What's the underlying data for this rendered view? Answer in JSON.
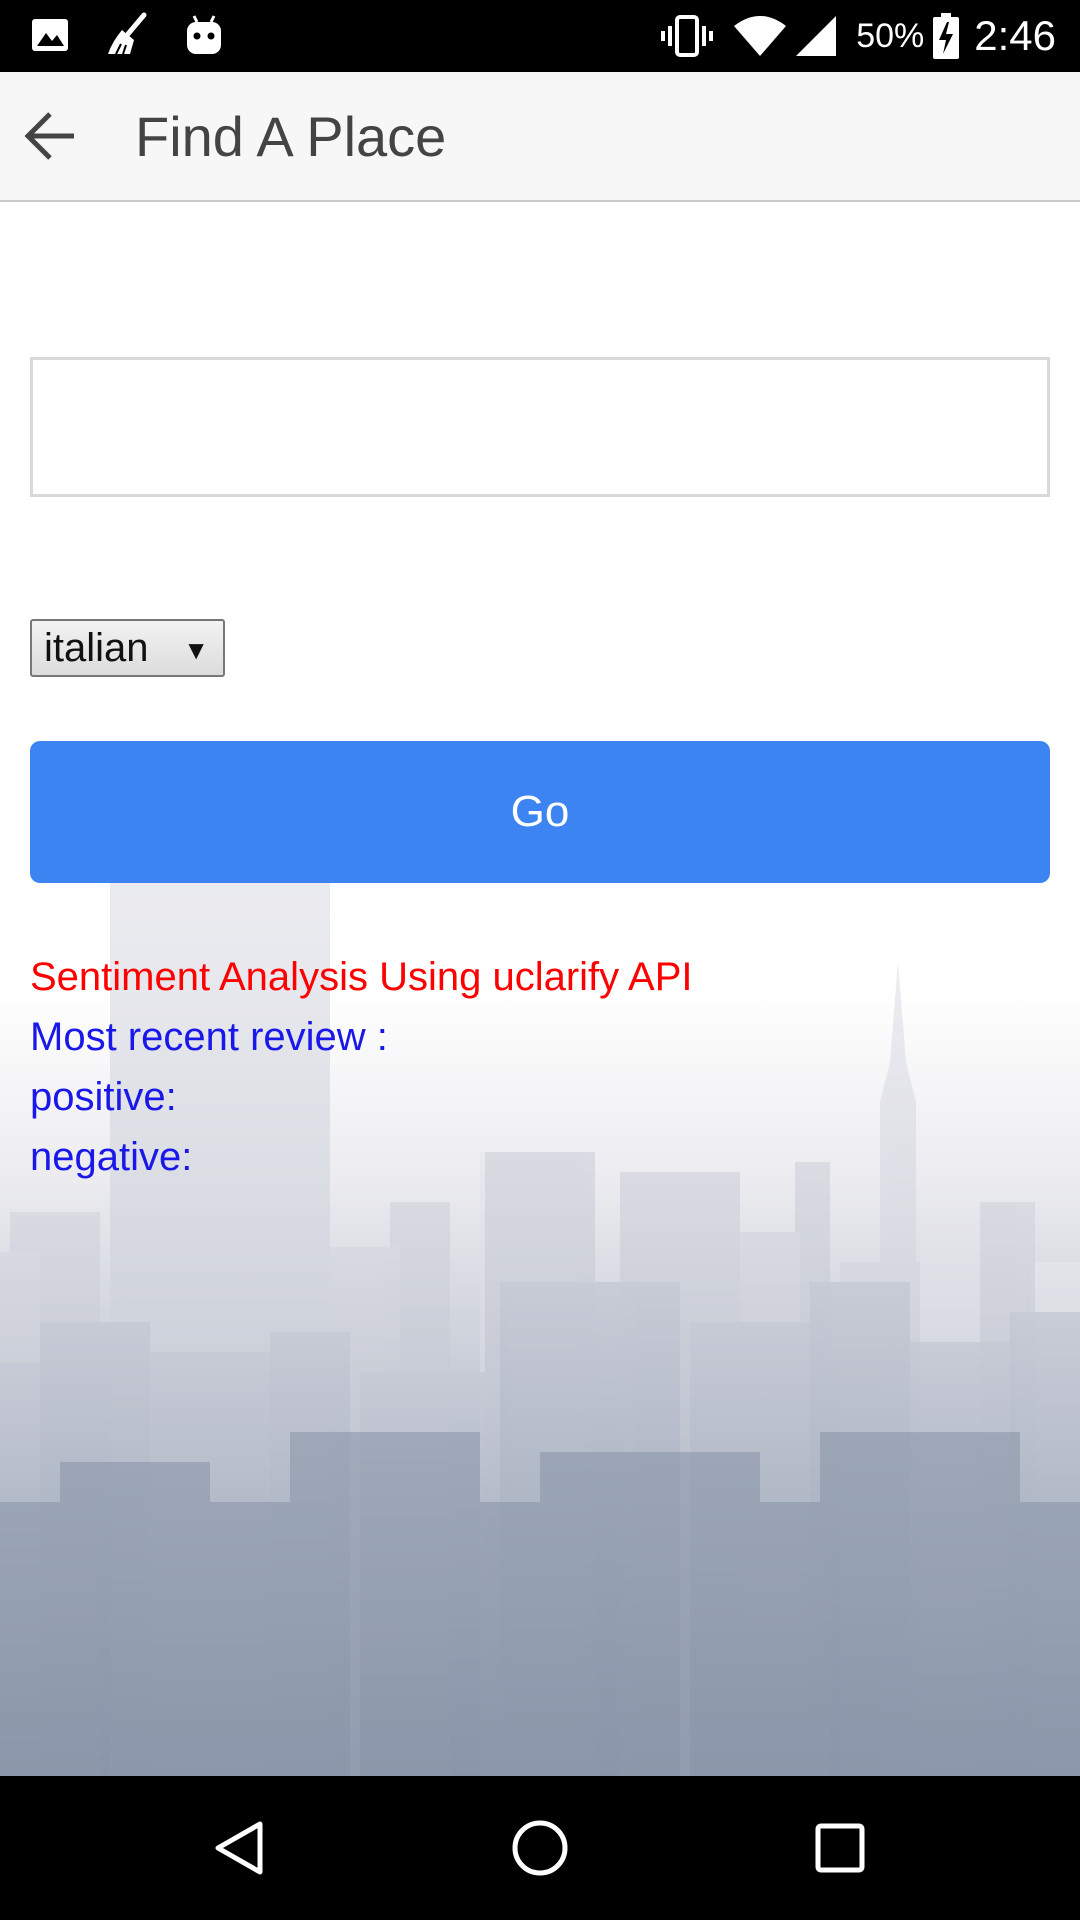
{
  "status_bar": {
    "left_icons": [
      "image-icon",
      "broom-icon",
      "android-icon"
    ],
    "right_icons": [
      "vibrate-icon",
      "wifi-icon",
      "signal-icon",
      "battery-charging-icon"
    ],
    "battery_percent": "50%",
    "time": "2:46"
  },
  "app_bar": {
    "title": "Find A Place",
    "back_icon": "arrow-back-icon"
  },
  "search": {
    "value": "",
    "placeholder": ""
  },
  "cuisine_select": {
    "selected": "italian",
    "arrow": "▼"
  },
  "go_button": {
    "label": "Go"
  },
  "results": {
    "heading": "Sentiment Analysis Using uclarify API",
    "recent_review_label": "Most recent review :",
    "positive_label": "positive:",
    "negative_label": "negative:"
  },
  "nav_bar": {
    "icons": [
      "back-triangle-icon",
      "home-circle-icon",
      "recents-square-icon"
    ]
  },
  "colors": {
    "accent": "#3b84f2",
    "heading_red": "#ff0000",
    "text_blue": "#1a18e8",
    "app_title": "#444444"
  }
}
